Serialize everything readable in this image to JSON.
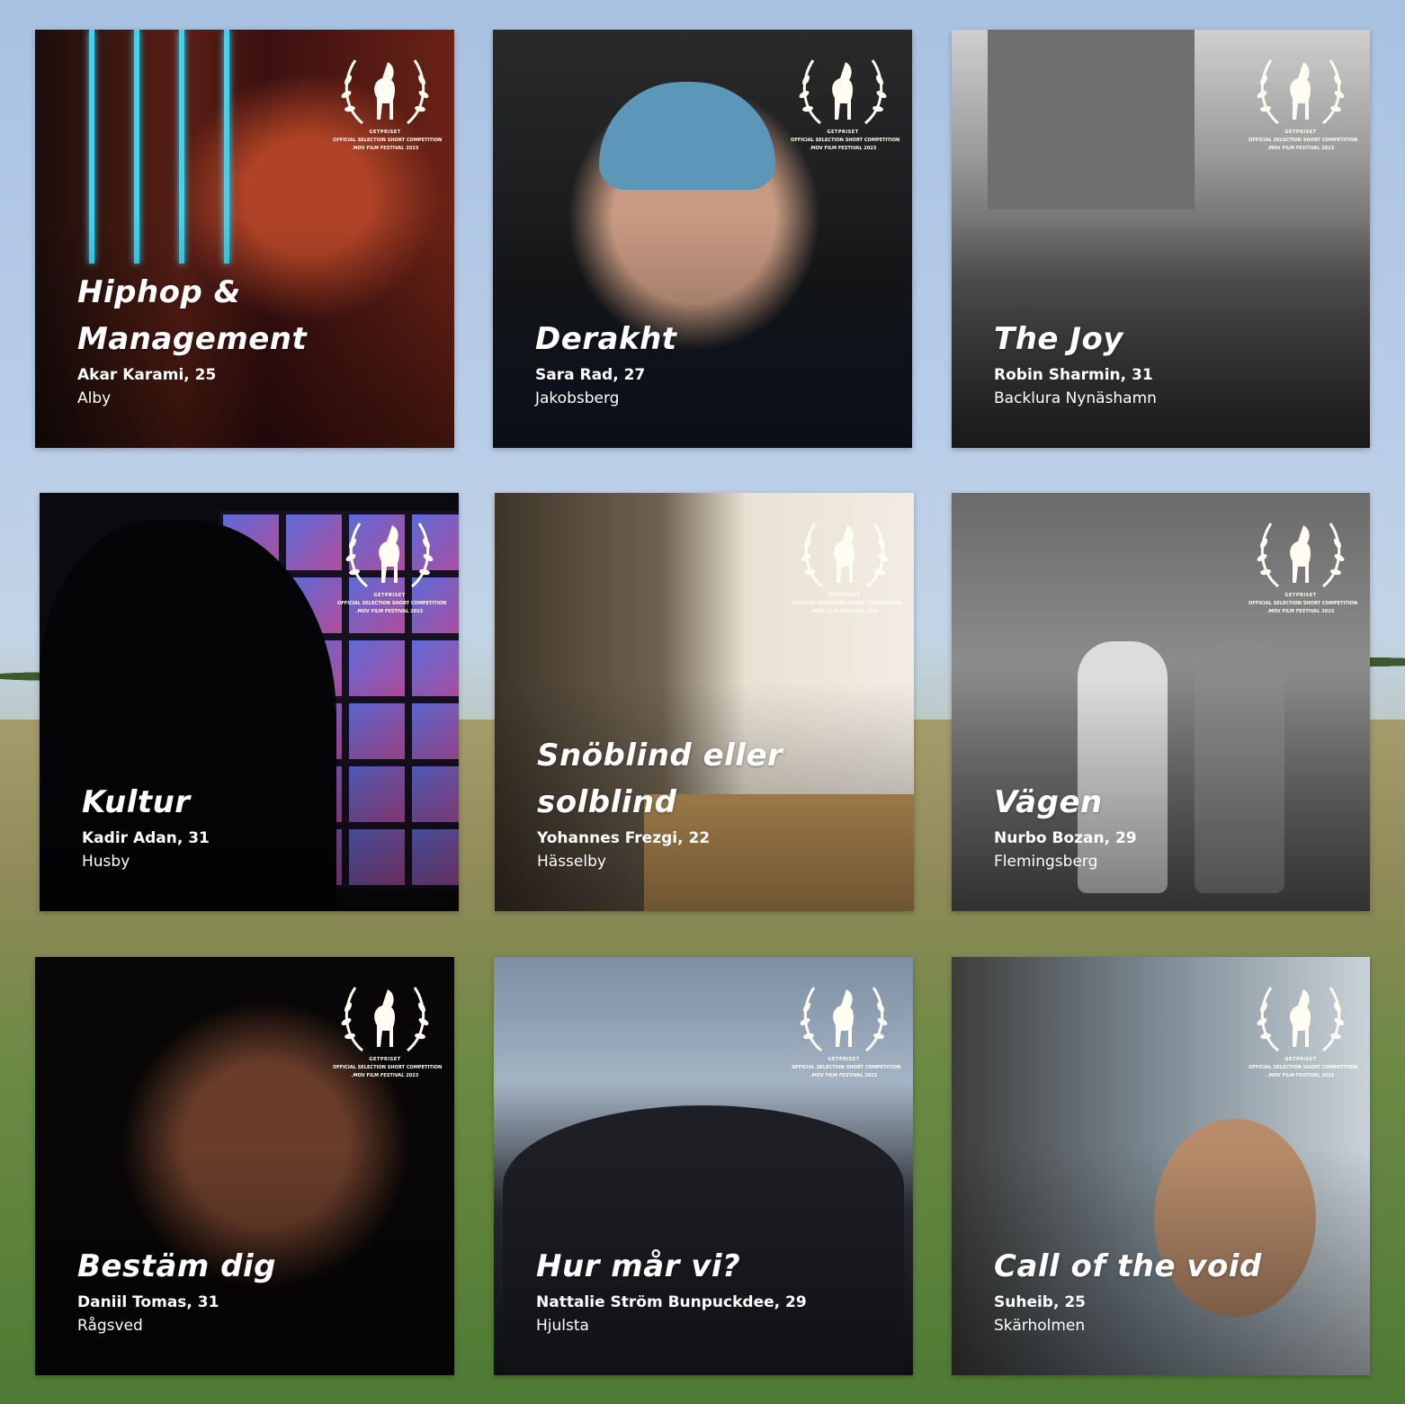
{
  "badge": {
    "top": "GETPRISET",
    "middle": "OFFICIAL SELECTION SHORT COMPETITION",
    "bottom": ".MOV FILM FESTIVAL 2023"
  },
  "films": [
    {
      "title": "Hiphop & Management",
      "author": "Akar Karami, 25",
      "place": "Alby"
    },
    {
      "title": "Derakht",
      "author": "Sara Rad, 27",
      "place": "Jakobsberg"
    },
    {
      "title": "The Joy",
      "author": "Robin Sharmin, 31",
      "place": "Backlura Nynäshamn"
    },
    {
      "title": "Kultur",
      "author": "Kadir Adan, 31",
      "place": "Husby"
    },
    {
      "title": "Snöblind eller solblind",
      "author": "Yohannes Frezgi, 22",
      "place": "Hässelby"
    },
    {
      "title": "Vägen",
      "author": "Nurbo Bozan, 29",
      "place": "Flemingsberg"
    },
    {
      "title": "Bestäm dig",
      "author": "Daniil Tomas, 31",
      "place": "Rågsved"
    },
    {
      "title": "Hur mår vi?",
      "author": "Nattalie Ström Bunpuckdee, 29",
      "place": "Hjulsta"
    },
    {
      "title": "Call of the void",
      "author": "Suheib, 25",
      "place": "Skärholmen"
    }
  ],
  "colors": {
    "badge": "#fffdf2",
    "text": "#ffffff"
  }
}
